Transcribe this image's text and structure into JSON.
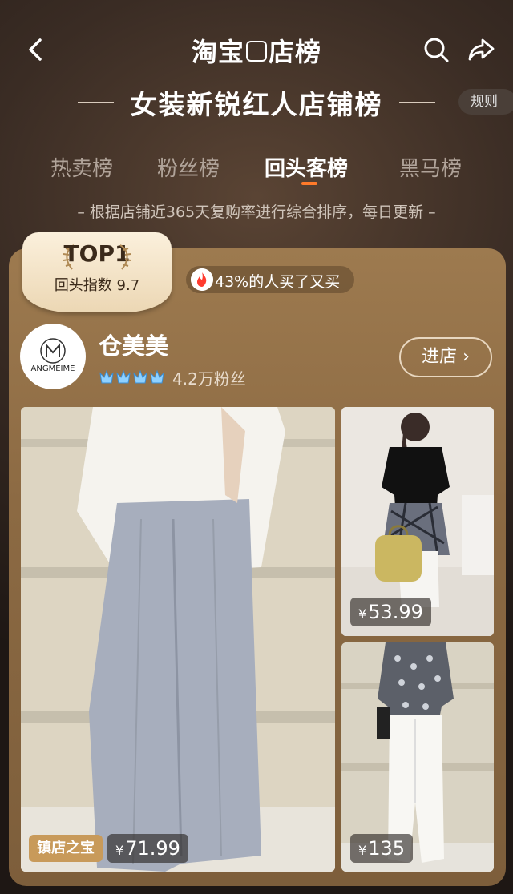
{
  "header": {
    "app_title_part1": "淘宝",
    "app_title_part2": "店榜",
    "list_title": "女装新锐红人店铺榜",
    "rules_label": "规则"
  },
  "tabs": [
    {
      "label": "热卖榜"
    },
    {
      "label": "粉丝榜"
    },
    {
      "label": "回头客榜"
    },
    {
      "label": "黑马榜"
    }
  ],
  "description": "– 根据店铺近365天复购率进行综合排序，每日更新 –",
  "shop": {
    "rank_label": "TOP1",
    "score_label": "回头指数 9.7",
    "repeat_text": "43%的人买了又买",
    "name": "仓美美",
    "avatar_text": "ANGMEIME",
    "fans": "4.2万粉丝",
    "enter_label": "进店",
    "treasure_label": "镇店之宝"
  },
  "products": [
    {
      "currency": "¥",
      "price": "71.99"
    },
    {
      "currency": "¥",
      "price": "53.99"
    },
    {
      "currency": "¥",
      "price": "135"
    }
  ],
  "colors": {
    "accent": "#ff7a2a",
    "card": "#9d7a4f",
    "badge": "#fbf0dc"
  }
}
